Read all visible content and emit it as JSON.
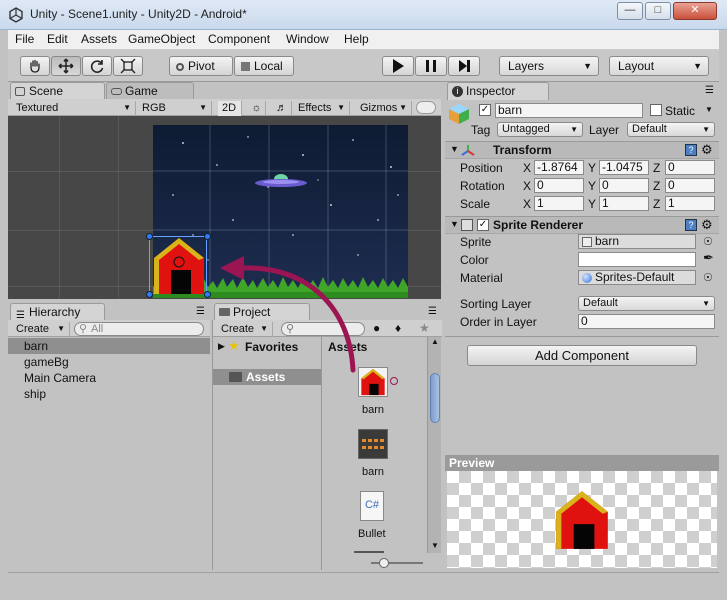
{
  "window": {
    "title": "Unity - Scene1.unity - Unity2D - Android*"
  },
  "menu": [
    "File",
    "Edit",
    "Assets",
    "GameObject",
    "Component",
    "Window",
    "Help"
  ],
  "toolbar": {
    "pivot_label": "Pivot",
    "local_label": "Local",
    "layers_label": "Layers",
    "layout_label": "Layout"
  },
  "scene_panel": {
    "tab_scene": "Scene",
    "tab_game": "Game",
    "render_mode": "Textured",
    "color_mode": "RGB",
    "mode_2d": "2D",
    "effects_label": "Effects",
    "gizmos_label": "Gizmos"
  },
  "hierarchy": {
    "tab": "Hierarchy",
    "create_label": "Create",
    "search_placeholder": "All",
    "items": [
      "barn",
      "gameBg",
      "Main Camera",
      "ship"
    ],
    "selected_index": 0
  },
  "project": {
    "tab": "Project",
    "create_label": "Create",
    "favorites_label": "Favorites",
    "assets_folder": "Assets",
    "assets_header": "Assets",
    "assets": [
      {
        "name": "barn",
        "icon": "barn-texture-icon"
      },
      {
        "name": "barn",
        "icon": "barn-sprite-sheet-icon"
      },
      {
        "name": "Bullet",
        "icon": "csharp-script-icon"
      }
    ]
  },
  "inspector": {
    "tab": "Inspector",
    "object_name": "barn",
    "static_label": "Static",
    "tag_label": "Tag",
    "tag_value": "Untagged",
    "layer_label": "Layer",
    "layer_value": "Default",
    "transform": {
      "title": "Transform",
      "position_label": "Position",
      "rotation_label": "Rotation",
      "scale_label": "Scale",
      "position": {
        "x": "-1.8764",
        "y": "-1.0475",
        "z": "0"
      },
      "rotation": {
        "x": "0",
        "y": "0",
        "z": "0"
      },
      "scale": {
        "x": "1",
        "y": "1",
        "z": "1"
      },
      "axis_x": "X",
      "axis_y": "Y",
      "axis_z": "Z"
    },
    "sprite_renderer": {
      "title": "Sprite Renderer",
      "sprite_label": "Sprite",
      "sprite_value": "barn",
      "color_label": "Color",
      "material_label": "Material",
      "material_value": "Sprites-Default",
      "sorting_layer_label": "Sorting Layer",
      "sorting_layer_value": "Default",
      "order_label": "Order in Layer",
      "order_value": "0"
    },
    "add_component_label": "Add Component"
  },
  "preview": {
    "title": "Preview"
  },
  "colors": {
    "accent_arrow": "#9b1553",
    "barn_red": "#e0120f",
    "barn_roof": "#d8b41a",
    "grass": "#3fa62a",
    "sky_top": "#0e1b33"
  }
}
